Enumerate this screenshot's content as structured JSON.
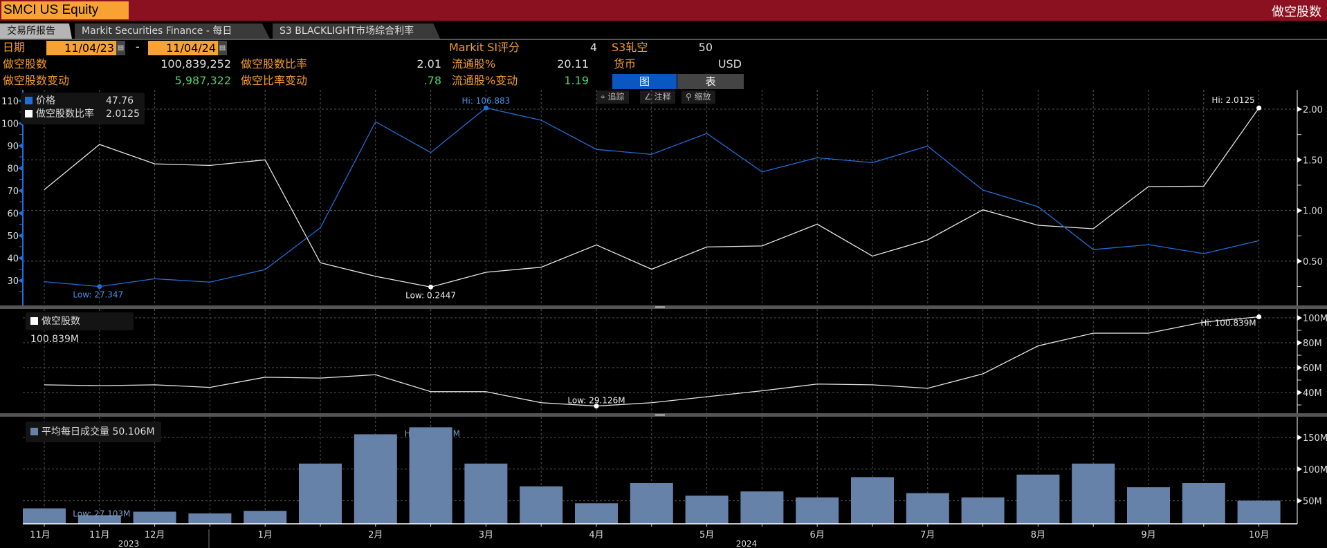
{
  "header": {
    "ticker": "SMCI US Equity",
    "title": "做空股数"
  },
  "tabs": [
    {
      "label": "交易所报告"
    },
    {
      "label": "Markit Securities Finance - 每日"
    },
    {
      "label": "S3 BLACKLIGHT市场综合利率"
    }
  ],
  "date": {
    "label": "日期",
    "start": "11/04/23",
    "separator": "-",
    "end": "11/04/24"
  },
  "stats": {
    "short_shares": {
      "label": "做空股数",
      "value": "100,839,252"
    },
    "short_shares_change": {
      "label": "做空股数变动",
      "value": "5,987,322"
    },
    "short_ratio": {
      "label": "做空股数比率",
      "value": "2.01"
    },
    "short_ratio_change": {
      "label": "做空比率变动",
      "value": ".78"
    },
    "markit_si": {
      "label": "Markit SI评分",
      "value": "4"
    },
    "float_pct": {
      "label": "流通股%",
      "value": "20.11"
    },
    "float_pct_change": {
      "label": "流通股%变动",
      "value": "1.19"
    },
    "s3_squeeze": {
      "label": "S3轧空",
      "value": "50"
    },
    "currency": {
      "label": "货币",
      "value": "USD"
    }
  },
  "view_toggle": {
    "chart": "图",
    "table": "表",
    "active": "chart"
  },
  "toolbar": {
    "track": "追踪",
    "annotate": "注释",
    "zoom": "缩放"
  },
  "colors": {
    "header": "#8b1120",
    "accent": "#f7a233",
    "price": "#1e6fd9",
    "ratio": "#e6e6e6",
    "volume": "#6682a8",
    "positive": "#4fd162"
  },
  "legend": {
    "price": {
      "label": "价格",
      "value": "47.76"
    },
    "ratio": {
      "label": "做空股数比率",
      "value": "2.0125"
    },
    "short_shares": {
      "label": "做空股数",
      "value": "100.839M"
    },
    "volume": {
      "label": "平均每日成交量",
      "value": "50.106M"
    }
  },
  "chart_data": [
    {
      "type": "line",
      "title": "价格 / 做空股数比率",
      "series": [
        {
          "name": "价格",
          "axis": "left",
          "values": [
            29.5,
            27.347,
            30.8,
            29.3,
            34.9,
            53.5,
            100.7,
            87,
            106.883,
            101.4,
            88.4,
            86.2,
            95.5,
            78.4,
            84.7,
            82.5,
            89.9,
            70.3,
            62.9,
            43.8,
            46,
            42,
            47.76
          ]
        },
        {
          "name": "做空股数比率",
          "axis": "right",
          "values": [
            1.205,
            1.652,
            1.46,
            1.445,
            1.5,
            0.484,
            0.35,
            0.2447,
            0.39,
            0.44,
            0.66,
            0.42,
            0.64,
            0.65,
            0.865,
            0.55,
            0.71,
            1.007,
            0.854,
            0.82,
            1.236,
            1.24,
            2.0125
          ]
        }
      ],
      "left_ylim": [
        22,
        113
      ],
      "left_ticks": [
        "110",
        "100",
        "90",
        "80",
        "70",
        "60",
        "50",
        "40",
        "30"
      ],
      "right_ylim": [
        0.1,
        2.15
      ],
      "right_ticks": [
        "2.00",
        "1.50",
        "1.00",
        "0.50"
      ],
      "annotations": {
        "price_hi": "Hi: 106.883",
        "price_low": "Low: 27.347",
        "ratio_hi": "Hi: 2.0125",
        "ratio_low": "Low: 0.2447"
      }
    },
    {
      "type": "line",
      "title": "做空股数",
      "series": [
        {
          "name": "做空股数",
          "unit": "M",
          "values": [
            46.2,
            45.5,
            46.2,
            44.1,
            52.3,
            51.6,
            54.3,
            40.7,
            40.7,
            31.8,
            29.126,
            31.8,
            36.6,
            41.4,
            46.8,
            46.2,
            43.4,
            55,
            77.5,
            87.7,
            87.7,
            96.6,
            100.839
          ]
        }
      ],
      "ylim": [
        20,
        107
      ],
      "ticks": [
        "100M",
        "80M",
        "60M",
        "40M"
      ],
      "annotations": {
        "hi": "Hi: 100.839M",
        "low": "Low: 29.126M"
      }
    },
    {
      "type": "bar",
      "title": "平均每日成交量",
      "series": [
        {
          "name": "平均每日成交量",
          "unit": "M",
          "values": [
            38,
            27.103,
            32.7,
            30,
            34,
            108.7,
            155,
            166,
            108.7,
            72.7,
            46,
            78,
            58,
            64.7,
            55.3,
            87.3,
            62,
            55.3,
            91.3,
            108.7,
            71.3,
            78,
            50.106
          ]
        }
      ],
      "ylim": [
        13.5,
        180
      ],
      "ticks": [
        "150M",
        "100M",
        "50M"
      ],
      "annotations": {
        "low": "Low: 27.103M",
        "hi_fragments": [
          "H",
          "M"
        ]
      }
    }
  ],
  "x_axis": {
    "month_labels": [
      {
        "i": 0,
        "t": "11月"
      },
      {
        "i": 1,
        "t": "11月"
      },
      {
        "i": 2,
        "t": "12月"
      },
      {
        "i": 4,
        "t": "1月"
      },
      {
        "i": 6,
        "t": "2月"
      },
      {
        "i": 8,
        "t": "3月"
      },
      {
        "i": 10,
        "t": "4月"
      },
      {
        "i": 12,
        "t": "5月"
      },
      {
        "i": 14,
        "t": "6月"
      },
      {
        "i": 16,
        "t": "7月"
      },
      {
        "i": 18,
        "t": "8月"
      },
      {
        "i": 20,
        "t": "9月"
      },
      {
        "i": 22,
        "t": "10月"
      }
    ],
    "years": [
      "2023",
      "2024"
    ]
  }
}
